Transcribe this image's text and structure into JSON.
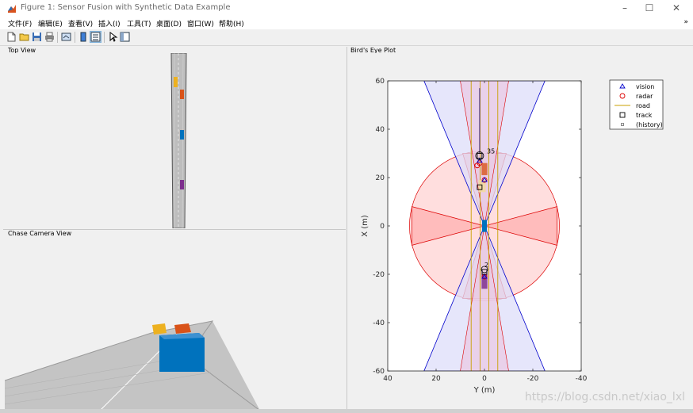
{
  "window": {
    "title": "Figure 1: Sensor Fusion with Synthetic Data Example",
    "minimize_glyph": "–",
    "maximize_glyph": "☐",
    "close_glyph": "✕"
  },
  "menu": {
    "items": [
      "文件(F)",
      "编辑(E)",
      "查看(V)",
      "插入(I)",
      "工具(T)",
      "桌面(D)",
      "窗口(W)",
      "帮助(H)"
    ],
    "overflow": "»"
  },
  "toolbar": {
    "icons": [
      "new-figure-icon",
      "open-file-icon",
      "save-icon",
      "print-icon",
      "link-plot-icon",
      "insert-colorbar-icon",
      "insert-legend-icon",
      "edit-plot-icon",
      "property-inspector-icon"
    ]
  },
  "panels": {
    "top_view": "Top View",
    "chase_view": "Chase Camera View",
    "birds_eye": "Bird's Eye Plot"
  },
  "colors": {
    "vision": "#0000cc",
    "radar": "#dd0000",
    "road": "#c8a000",
    "ego": "#0072bd",
    "car_yellow": "#edb120",
    "car_orange": "#d95319",
    "car_purple": "#7e2f8e",
    "radar_fill": "#ffdede",
    "vision_fill": "#dedefa"
  },
  "chart_data": {
    "type": "scatter",
    "title": "Bird's Eye Plot",
    "xlabel": "Y (m)",
    "ylabel": "X (m)",
    "xlim": [
      40,
      -40
    ],
    "ylim": [
      -60,
      60
    ],
    "xticks": [
      40,
      20,
      0,
      -20,
      -40
    ],
    "yticks": [
      60,
      40,
      20,
      0,
      -20,
      -40,
      -60
    ],
    "legend_position": "top-right",
    "legend": [
      {
        "label": "vision",
        "marker": "triangle",
        "color": "#0000cc"
      },
      {
        "label": "radar",
        "marker": "circle",
        "color": "#dd0000"
      },
      {
        "label": "road",
        "marker": "line",
        "color": "#c8a000"
      },
      {
        "label": "track",
        "marker": "square",
        "color": "#000000"
      },
      {
        "label": "(history)",
        "marker": "small-square",
        "color": "#555555"
      }
    ],
    "track_labels": [
      {
        "text": "35",
        "x": -1,
        "y": 30
      },
      {
        "text": "2",
        "x": 0,
        "y": -17
      }
    ],
    "tracks": [
      {
        "x": 2,
        "y": 29
      },
      {
        "x": 2,
        "y": 16
      },
      {
        "x": 0,
        "y": -19
      }
    ],
    "vision_detections": [
      {
        "x": 2,
        "y": 27
      },
      {
        "x": 0,
        "y": 19
      },
      {
        "x": 0,
        "y": -21
      }
    ],
    "radar_detections": [
      {
        "x": 2,
        "y": 26
      },
      {
        "x": 3,
        "y": 25
      },
      {
        "x": 0,
        "y": 19
      },
      {
        "x": 0,
        "y": -21
      }
    ]
  }
}
